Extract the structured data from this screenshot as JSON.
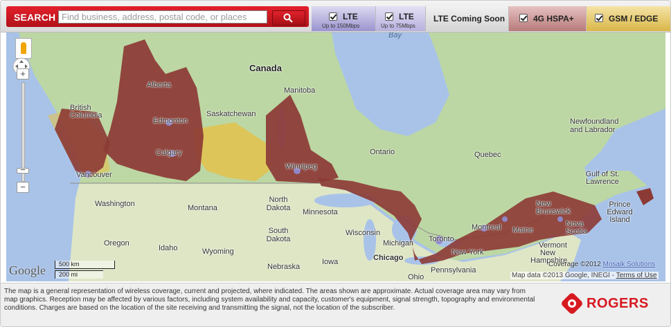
{
  "search": {
    "label": "SEARCH",
    "placeholder": "Find business, address, postal code, or places"
  },
  "legend": [
    {
      "label": "LTE",
      "sub": "Up to 150Mbps",
      "checked": true,
      "color": "#9a94cf"
    },
    {
      "label": "LTE",
      "sub": "Up to 75Mbps",
      "checked": true,
      "color": "#b7b1de"
    },
    {
      "label": "LTE Coming Soon",
      "sub": "",
      "checked": false,
      "color": "#d4d4d4"
    },
    {
      "label": "4G HSPA+",
      "sub": "",
      "checked": true,
      "color": "#b77a7a"
    },
    {
      "label": "GSM / EDGE",
      "sub": "",
      "checked": true,
      "color": "#d9b748"
    }
  ],
  "map": {
    "labels": {
      "canada": "Canada",
      "alberta": "Alberta",
      "manitoba": "Manitoba",
      "bc": "British Columbia",
      "edmonton": "Edmonton",
      "saskatchewan": "Saskatchewan",
      "calgary": "Calgary",
      "winnipeg": "Winnipeg",
      "ontario": "Ontario",
      "quebec": "Quebec",
      "newfoundland": "Newfoundland and Labrador",
      "vancouver": "Vancouver",
      "washington": "Washington",
      "montana": "Montana",
      "north_dakota": "North Dakota",
      "minnesota": "Minnesota",
      "south_dakota": "South Dakota",
      "wisconsin": "Wisconsin",
      "michigan": "Michigan",
      "oregon": "Oregon",
      "idaho": "Idaho",
      "wyoming": "Wyoming",
      "nebraska": "Nebraska",
      "iowa": "Iowa",
      "chicago": "Chicago",
      "ohio": "Ohio",
      "pennsylvania": "Pennsylvania",
      "new_york": "New York",
      "toronto": "Toronto",
      "montreal": "Montreal",
      "maine": "Maine",
      "vermont": "Vermont",
      "new_hampshire": "New Hampshire",
      "new_brunswick": "New Brunswick",
      "nova_scotia": "Nova Scotia",
      "pei": "Prince Edward Island",
      "gulf": "Gulf of St. Lawrence",
      "bay": "Bay"
    },
    "scale_km": "500 km",
    "scale_mi": "200 mi",
    "google": "Google",
    "coverage_text": "Coverage ©2012",
    "coverage_link": "Mosaik Solutions",
    "attribution": "Map data ©2013 Google, INEGI -",
    "terms": "Terms of Use"
  },
  "footer": {
    "disclaimer": "The map is a general representation of wireless coverage, current and projected, where indicated. The areas shown are approximate. Actual coverage area may vary from map graphics. Reception may be affected by various factors, including system availability and capacity, customer's equipment, signal strength, topography and environmental conditions. Charges are based on the location of the site receiving and transmitting the signal, not the location of the subscriber.",
    "brand": "ROGERS"
  }
}
